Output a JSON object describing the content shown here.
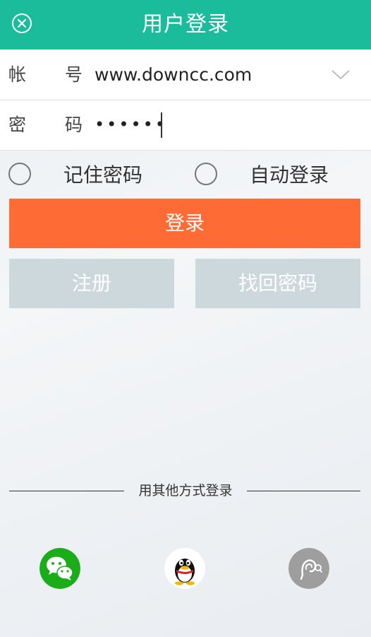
{
  "header": {
    "title": "用户登录",
    "close_icon": "close-circle-icon"
  },
  "form": {
    "account_label_1": "帐",
    "account_label_2": "号",
    "account_value": "www.downcc.com",
    "password_label_1": "密",
    "password_label_2": "码",
    "password_value": "••••••"
  },
  "options": {
    "remember": "记住密码",
    "auto_login": "自动登录"
  },
  "buttons": {
    "login": "登录",
    "register": "注册",
    "recover": "找回密码"
  },
  "other_login": {
    "label": "用其他方式登录",
    "methods": [
      {
        "icon": "wechat-icon"
      },
      {
        "icon": "qq-icon"
      },
      {
        "icon": "weibo-ear-icon"
      }
    ]
  },
  "colors": {
    "header": "#1bbc9b",
    "login": "#ff6b35",
    "secondary": "#cdd8dd",
    "wechat": "#1aad19",
    "third": "#9e9e9e"
  }
}
